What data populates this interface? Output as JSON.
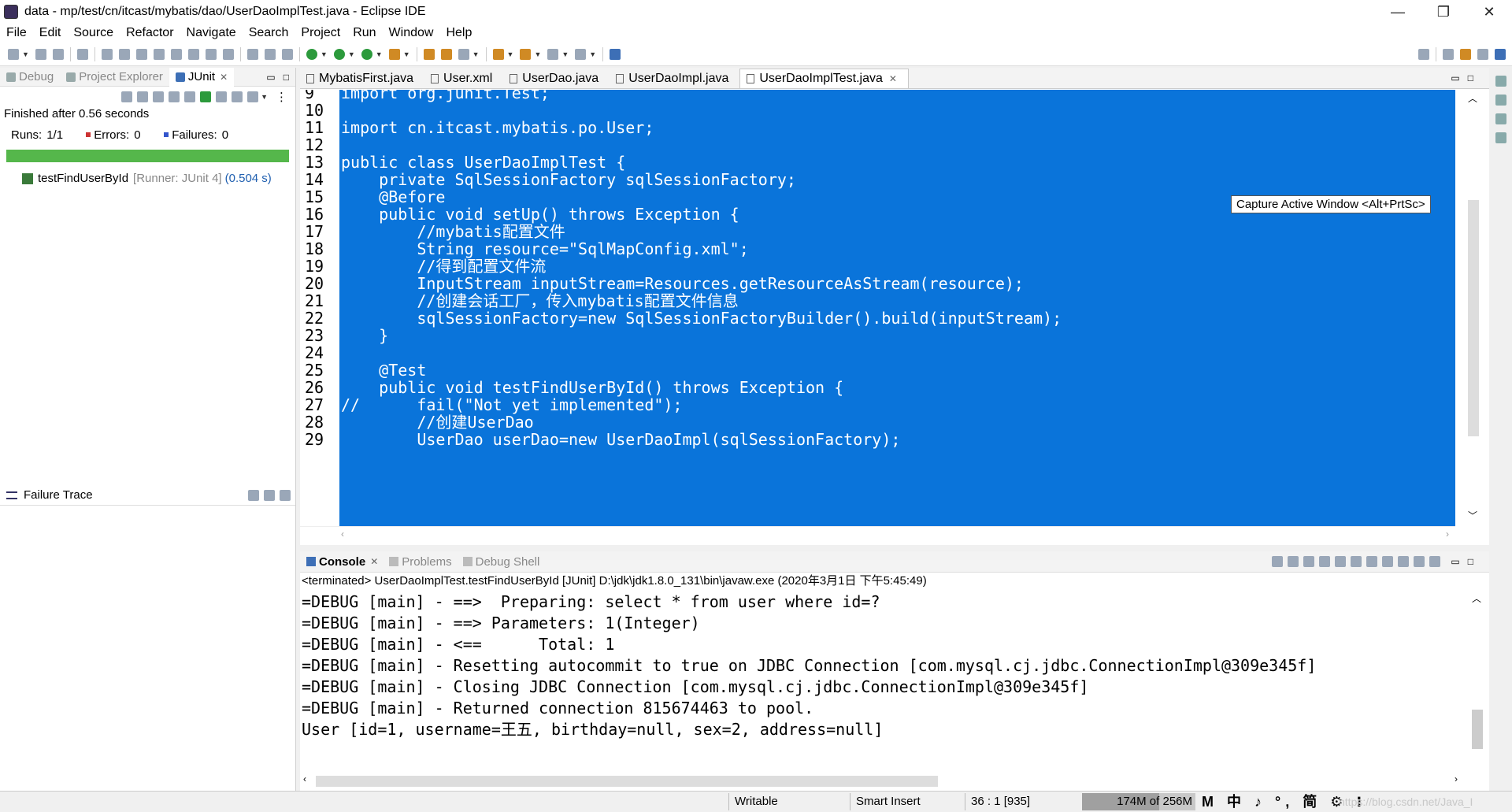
{
  "window": {
    "title": "data - mp/test/cn/itcast/mybatis/dao/UserDaoImplTest.java - Eclipse IDE",
    "minimize": "—",
    "restore": "❐",
    "close": "✕"
  },
  "menu": [
    "File",
    "Edit",
    "Source",
    "Refactor",
    "Navigate",
    "Search",
    "Project",
    "Run",
    "Window",
    "Help"
  ],
  "left_tabs": [
    {
      "label": "Debug",
      "active": false
    },
    {
      "label": "Project Explorer",
      "active": false
    },
    {
      "label": "JUnit",
      "active": true
    }
  ],
  "junit": {
    "finished": "Finished after 0.56 seconds",
    "runs_label": "Runs:",
    "runs_value": "1/1",
    "errors_label": "Errors:",
    "errors_value": "0",
    "failures_label": "Failures:",
    "failures_value": "0",
    "progress": 1.0,
    "test_name": "testFindUserById",
    "test_runner": "[Runner: JUnit 4]",
    "test_time": "(0.504 s)",
    "failure_trace": "Failure Trace"
  },
  "editor_tabs": [
    {
      "label": "MybatisFirst.java",
      "active": false
    },
    {
      "label": "User.xml",
      "active": false
    },
    {
      "label": "UserDao.java",
      "active": false
    },
    {
      "label": "UserDaoImpl.java",
      "active": false
    },
    {
      "label": "UserDaoImplTest.java",
      "active": true
    }
  ],
  "code_lines": [
    {
      "n": "9",
      "t": "import org.junit.Test;"
    },
    {
      "n": "10",
      "t": ""
    },
    {
      "n": "11",
      "t": "import cn.itcast.mybatis.po.User;"
    },
    {
      "n": "12",
      "t": ""
    },
    {
      "n": "13",
      "t": "public class UserDaoImplTest {"
    },
    {
      "n": "14",
      "t": "    private SqlSessionFactory sqlSessionFactory;"
    },
    {
      "n": "15",
      "t": "    @Before"
    },
    {
      "n": "16",
      "t": "    public void setUp() throws Exception {"
    },
    {
      "n": "17",
      "t": "        //mybatis配置文件"
    },
    {
      "n": "18",
      "t": "        String resource=\"SqlMapConfig.xml\";"
    },
    {
      "n": "19",
      "t": "        //得到配置文件流"
    },
    {
      "n": "20",
      "t": "        InputStream inputStream=Resources.getResourceAsStream(resource);"
    },
    {
      "n": "21",
      "t": "        //创建会话工厂，传入mybatis配置文件信息"
    },
    {
      "n": "22",
      "t": "        sqlSessionFactory=new SqlSessionFactoryBuilder().build(inputStream);"
    },
    {
      "n": "23",
      "t": "    }"
    },
    {
      "n": "24",
      "t": ""
    },
    {
      "n": "25",
      "t": "    @Test"
    },
    {
      "n": "26",
      "t": "    public void testFindUserById() throws Exception {"
    },
    {
      "n": "27",
      "t": "//      fail(\"Not yet implemented\");"
    },
    {
      "n": "28",
      "t": "        //创建UserDao"
    },
    {
      "n": "29",
      "t": "        UserDao userDao=new UserDaoImpl(sqlSessionFactory);"
    }
  ],
  "tooltip": "Capture Active Window <Alt+PrtSc>",
  "console_tabs": [
    {
      "label": "Console",
      "active": true
    },
    {
      "label": "Problems",
      "active": false
    },
    {
      "label": "Debug Shell",
      "active": false
    }
  ],
  "console": {
    "terminated": "<terminated> UserDaoImplTest.testFindUserById [JUnit] D:\\jdk\\jdk1.8.0_131\\bin\\javaw.exe (2020年3月1日 下午5:45:49)",
    "lines": [
      "=DEBUG [main] - ==>  Preparing: select * from user where id=?",
      "=DEBUG [main] - ==> Parameters: 1(Integer)",
      "=DEBUG [main] - <==      Total: 1",
      "=DEBUG [main] - Resetting autocommit to true on JDBC Connection [com.mysql.cj.jdbc.ConnectionImpl@309e345f]",
      "=DEBUG [main] - Closing JDBC Connection [com.mysql.cj.jdbc.ConnectionImpl@309e345f]",
      "=DEBUG [main] - Returned connection 815674463 to pool.",
      "User [id=1, username=王五, birthday=null, sex=2, address=null]"
    ]
  },
  "status": {
    "writable": "Writable",
    "insert_mode": "Smart Insert",
    "position": "36 : 1 [935]",
    "heap": "174M of 256M",
    "heap_fraction": 0.68,
    "ime": "M 中 ♪ °, 简 ⚙ ⁝",
    "watermark": "https://blog.csdn.net/Java_I"
  }
}
